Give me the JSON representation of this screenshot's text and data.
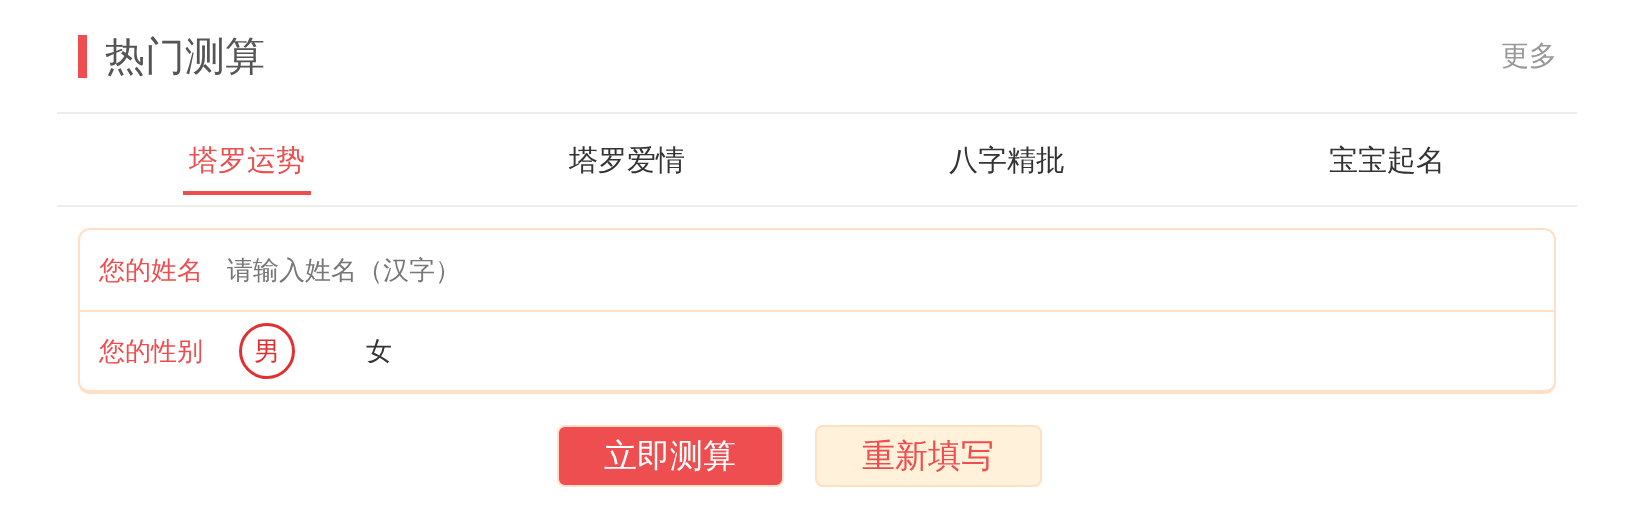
{
  "header": {
    "title": "热门测算",
    "more_link": "更多"
  },
  "tabs": [
    {
      "label": "塔罗运势",
      "selected": true
    },
    {
      "label": "塔罗爱情",
      "selected": false
    },
    {
      "label": "八字精批",
      "selected": false
    },
    {
      "label": "宝宝起名",
      "selected": false
    }
  ],
  "form": {
    "name_field": {
      "label": "您的姓名",
      "placeholder": "请输入姓名（汉字）"
    },
    "gender": {
      "label": "您的性别",
      "options": [
        {
          "label": "男",
          "selected": true
        },
        {
          "label": "女",
          "selected": false
        }
      ]
    }
  },
  "buttons": [
    {
      "label": "立即测算",
      "kind": "primary"
    },
    {
      "label": "重新填写",
      "kind": "secondary"
    }
  ]
}
